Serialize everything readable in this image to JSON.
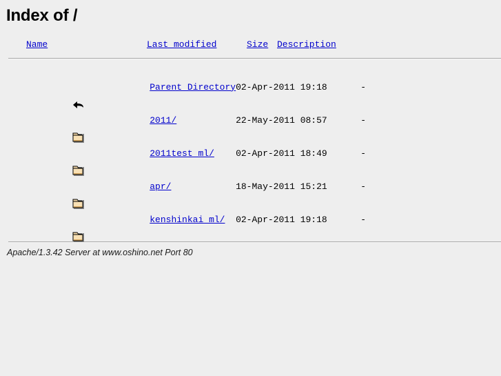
{
  "page": {
    "title": "Index of /",
    "background_color": "#eeeeee",
    "link_color": "#0000cc"
  },
  "table": {
    "columns": [
      {
        "key": "icon",
        "label": ""
      },
      {
        "key": "name",
        "label": "Name"
      },
      {
        "key": "last_modified",
        "label": "Last modified"
      },
      {
        "key": "size",
        "label": "Size"
      },
      {
        "key": "description",
        "label": "Description"
      }
    ],
    "rows": [
      {
        "icon": "back-arrow-icon",
        "name": "Parent Directory",
        "last_modified": "02-Apr-2011 19:18",
        "size": "-",
        "description": ""
      },
      {
        "icon": "folder-icon",
        "name": "2011/",
        "last_modified": "22-May-2011 08:57",
        "size": "-",
        "description": ""
      },
      {
        "icon": "folder-icon",
        "name": "2011test_ml/",
        "last_modified": "02-Apr-2011 18:49",
        "size": "-",
        "description": ""
      },
      {
        "icon": "folder-icon",
        "name": "apr/",
        "last_modified": "18-May-2011 15:21",
        "size": "-",
        "description": ""
      },
      {
        "icon": "folder-icon",
        "name": "kenshinkai_ml/",
        "last_modified": "02-Apr-2011 19:18",
        "size": "-",
        "description": ""
      }
    ]
  },
  "footer": {
    "signature": "Apache/1.3.42 Server at www.oshino.net Port 80"
  }
}
